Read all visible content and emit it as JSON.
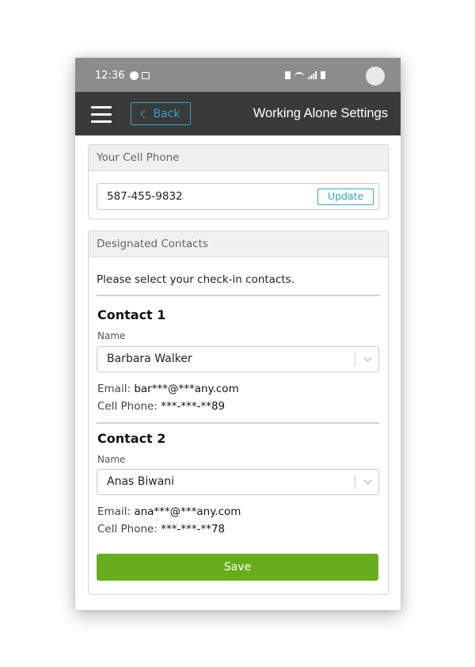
{
  "status_bar": {
    "time": "12:36"
  },
  "app_bar": {
    "back_label": "Back",
    "title": "Working Alone Settings"
  },
  "cell_phone_card": {
    "header": "Your Cell Phone",
    "phone_value": "587-455-9832",
    "update_label": "Update"
  },
  "contacts_card": {
    "header": "Designated Contacts",
    "intro": "Please select your check-in contacts.",
    "name_label": "Name",
    "email_label": "Email:",
    "cell_label": "Cell Phone:",
    "contacts": [
      {
        "title": "Contact 1",
        "name": "Barbara Walker",
        "email": "bar***@***any.com",
        "cell": "***-***-**89"
      },
      {
        "title": "Contact 2",
        "name": "Anas Biwani",
        "email": "ana***@***any.com",
        "cell": "***-***-**78"
      }
    ],
    "save_label": "Save"
  },
  "colors": {
    "accent": "#2fa7c9",
    "save_green": "#67ad1c",
    "app_bar": "#3a3a3a",
    "status_bar": "#8c8c8c"
  },
  "icons": [
    "menu-icon",
    "chevron-left-icon",
    "chevron-down-icon",
    "avatar"
  ]
}
